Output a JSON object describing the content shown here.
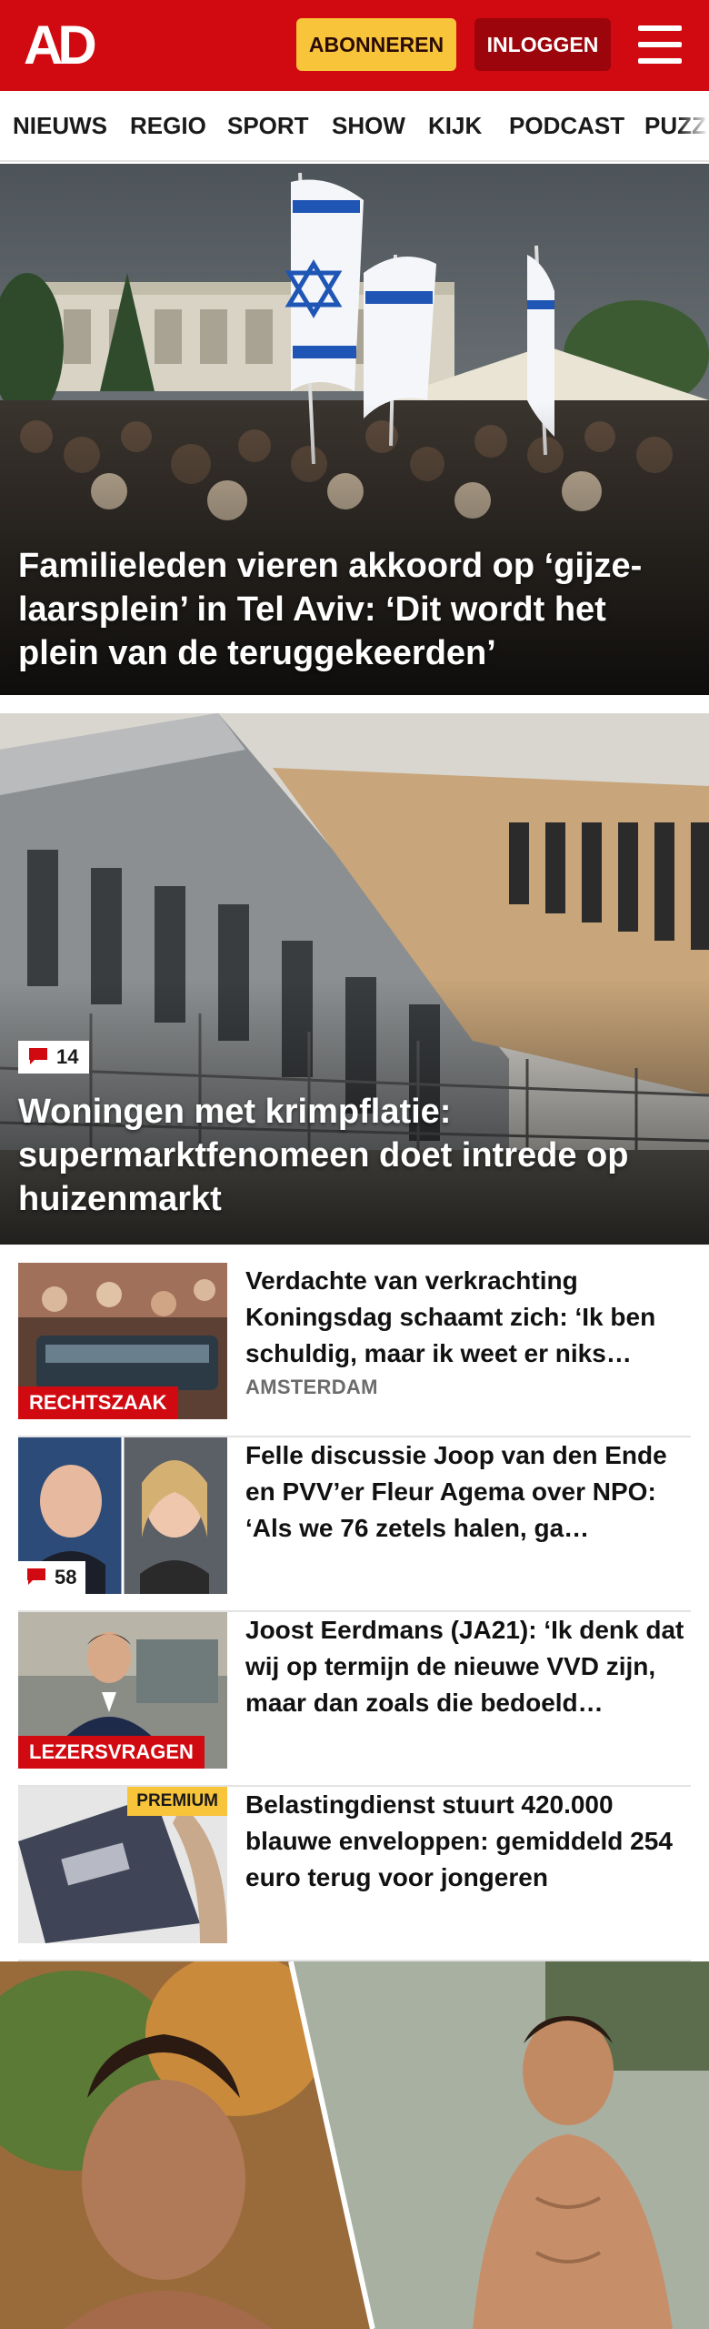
{
  "header": {
    "logo": "AD",
    "subscribe_label": "ABONNEREN",
    "login_label": "INLOGGEN",
    "menu_icon": "hamburger-icon",
    "brand_color": "#d10a11"
  },
  "nav": {
    "items": [
      "NIEUWS",
      "REGIO",
      "SPORT",
      "SHOW",
      "KIJK",
      "PODCAST",
      "PUZZ"
    ]
  },
  "hero": {
    "title": "Familieleden vieren akkoord op ‘gijze­laarsplein’ in Tel Aviv: ‘Dit wordt het plein van de teruggekeerden’"
  },
  "second_hero": {
    "comment_count": "14",
    "title": "Woningen met krimpflatie: supermarktfenomeen doet intrede op huizenmarkt"
  },
  "articles": [
    {
      "title": "Verdachte van verkrachting Koningsdag schaamt zich: ‘Ik ben schuldig, maar ik weet er niks…",
      "kicker": "AMSTERDAM",
      "tag": "RECHTSZAAK"
    },
    {
      "title": "Felle discussie Joop van den Ende en PVV’er Fleur Agema over NPO: ‘Als we 76 zetels halen, ga…",
      "comment_count": "58"
    },
    {
      "title": "Joost Eerdmans (JA21): ‘Ik denk dat wij op termijn de nieuwe VVD zijn, maar dan zoals die bedoeld…",
      "tag": "LEZERSVRAGEN"
    },
    {
      "title": "Belastingdienst stuurt 420.000 blauwe enveloppen: gemiddeld 254 euro terug voor jongeren",
      "badge": "PREMIUM"
    }
  ]
}
